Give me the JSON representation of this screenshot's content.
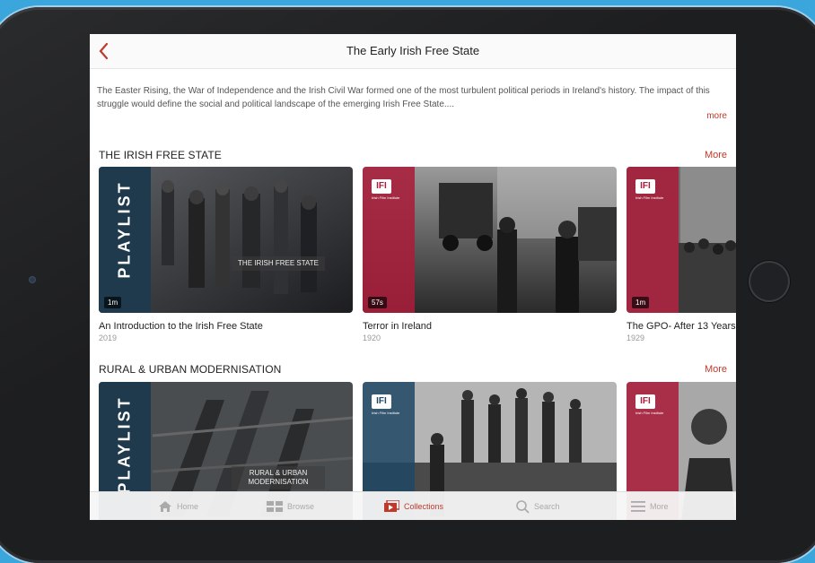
{
  "nav": {
    "title": "The Early Irish Free State"
  },
  "description": {
    "text": "The Easter Rising, the War of Independence and the Irish Civil War formed one of the most turbulent political periods in Ireland's history. The impact of this struggle would define the social and political landscape of the emerging Irish Free State....",
    "more": "more"
  },
  "sections": [
    {
      "title": "THE IRISH FREE STATE",
      "more": "More",
      "items": [
        {
          "badge": "PLAYLIST",
          "overlay": "THE IRISH FREE STATE",
          "duration": "1m",
          "title": "An Introduction to the Irish Free State",
          "year": "2019"
        },
        {
          "logo": "IFI",
          "logo_sub": "Irish Film Institute",
          "duration": "57s",
          "title": "Terror in Ireland",
          "year": "1920"
        },
        {
          "logo": "IFI",
          "logo_sub": "Irish Film Institute",
          "duration": "1m",
          "title": "The GPO- After 13 Years",
          "year": "1929"
        }
      ]
    },
    {
      "title": "RURAL & URBAN MODERNISATION",
      "more": "More",
      "items": [
        {
          "badge": "PLAYLIST",
          "overlay": "RURAL & URBAN MODERNISATION"
        },
        {
          "logo": "IFI",
          "logo_sub": "Irish Film Institute"
        },
        {
          "logo": "IFI",
          "logo_sub": "Irish Film Institute"
        }
      ]
    }
  ],
  "tabbar": [
    {
      "label": "Home",
      "icon": "home-icon",
      "active": false
    },
    {
      "label": "Browse",
      "icon": "browse-icon",
      "active": false
    },
    {
      "label": "Collections",
      "icon": "collections-icon",
      "active": true
    },
    {
      "label": "Search",
      "icon": "search-icon",
      "active": false
    },
    {
      "label": "More",
      "icon": "menu-icon",
      "active": false
    }
  ],
  "colors": {
    "accent": "#c0392b",
    "playlist_band": "#1f3a4d",
    "ifi_red": "#a81e3a",
    "background": "#3aa6dc"
  }
}
